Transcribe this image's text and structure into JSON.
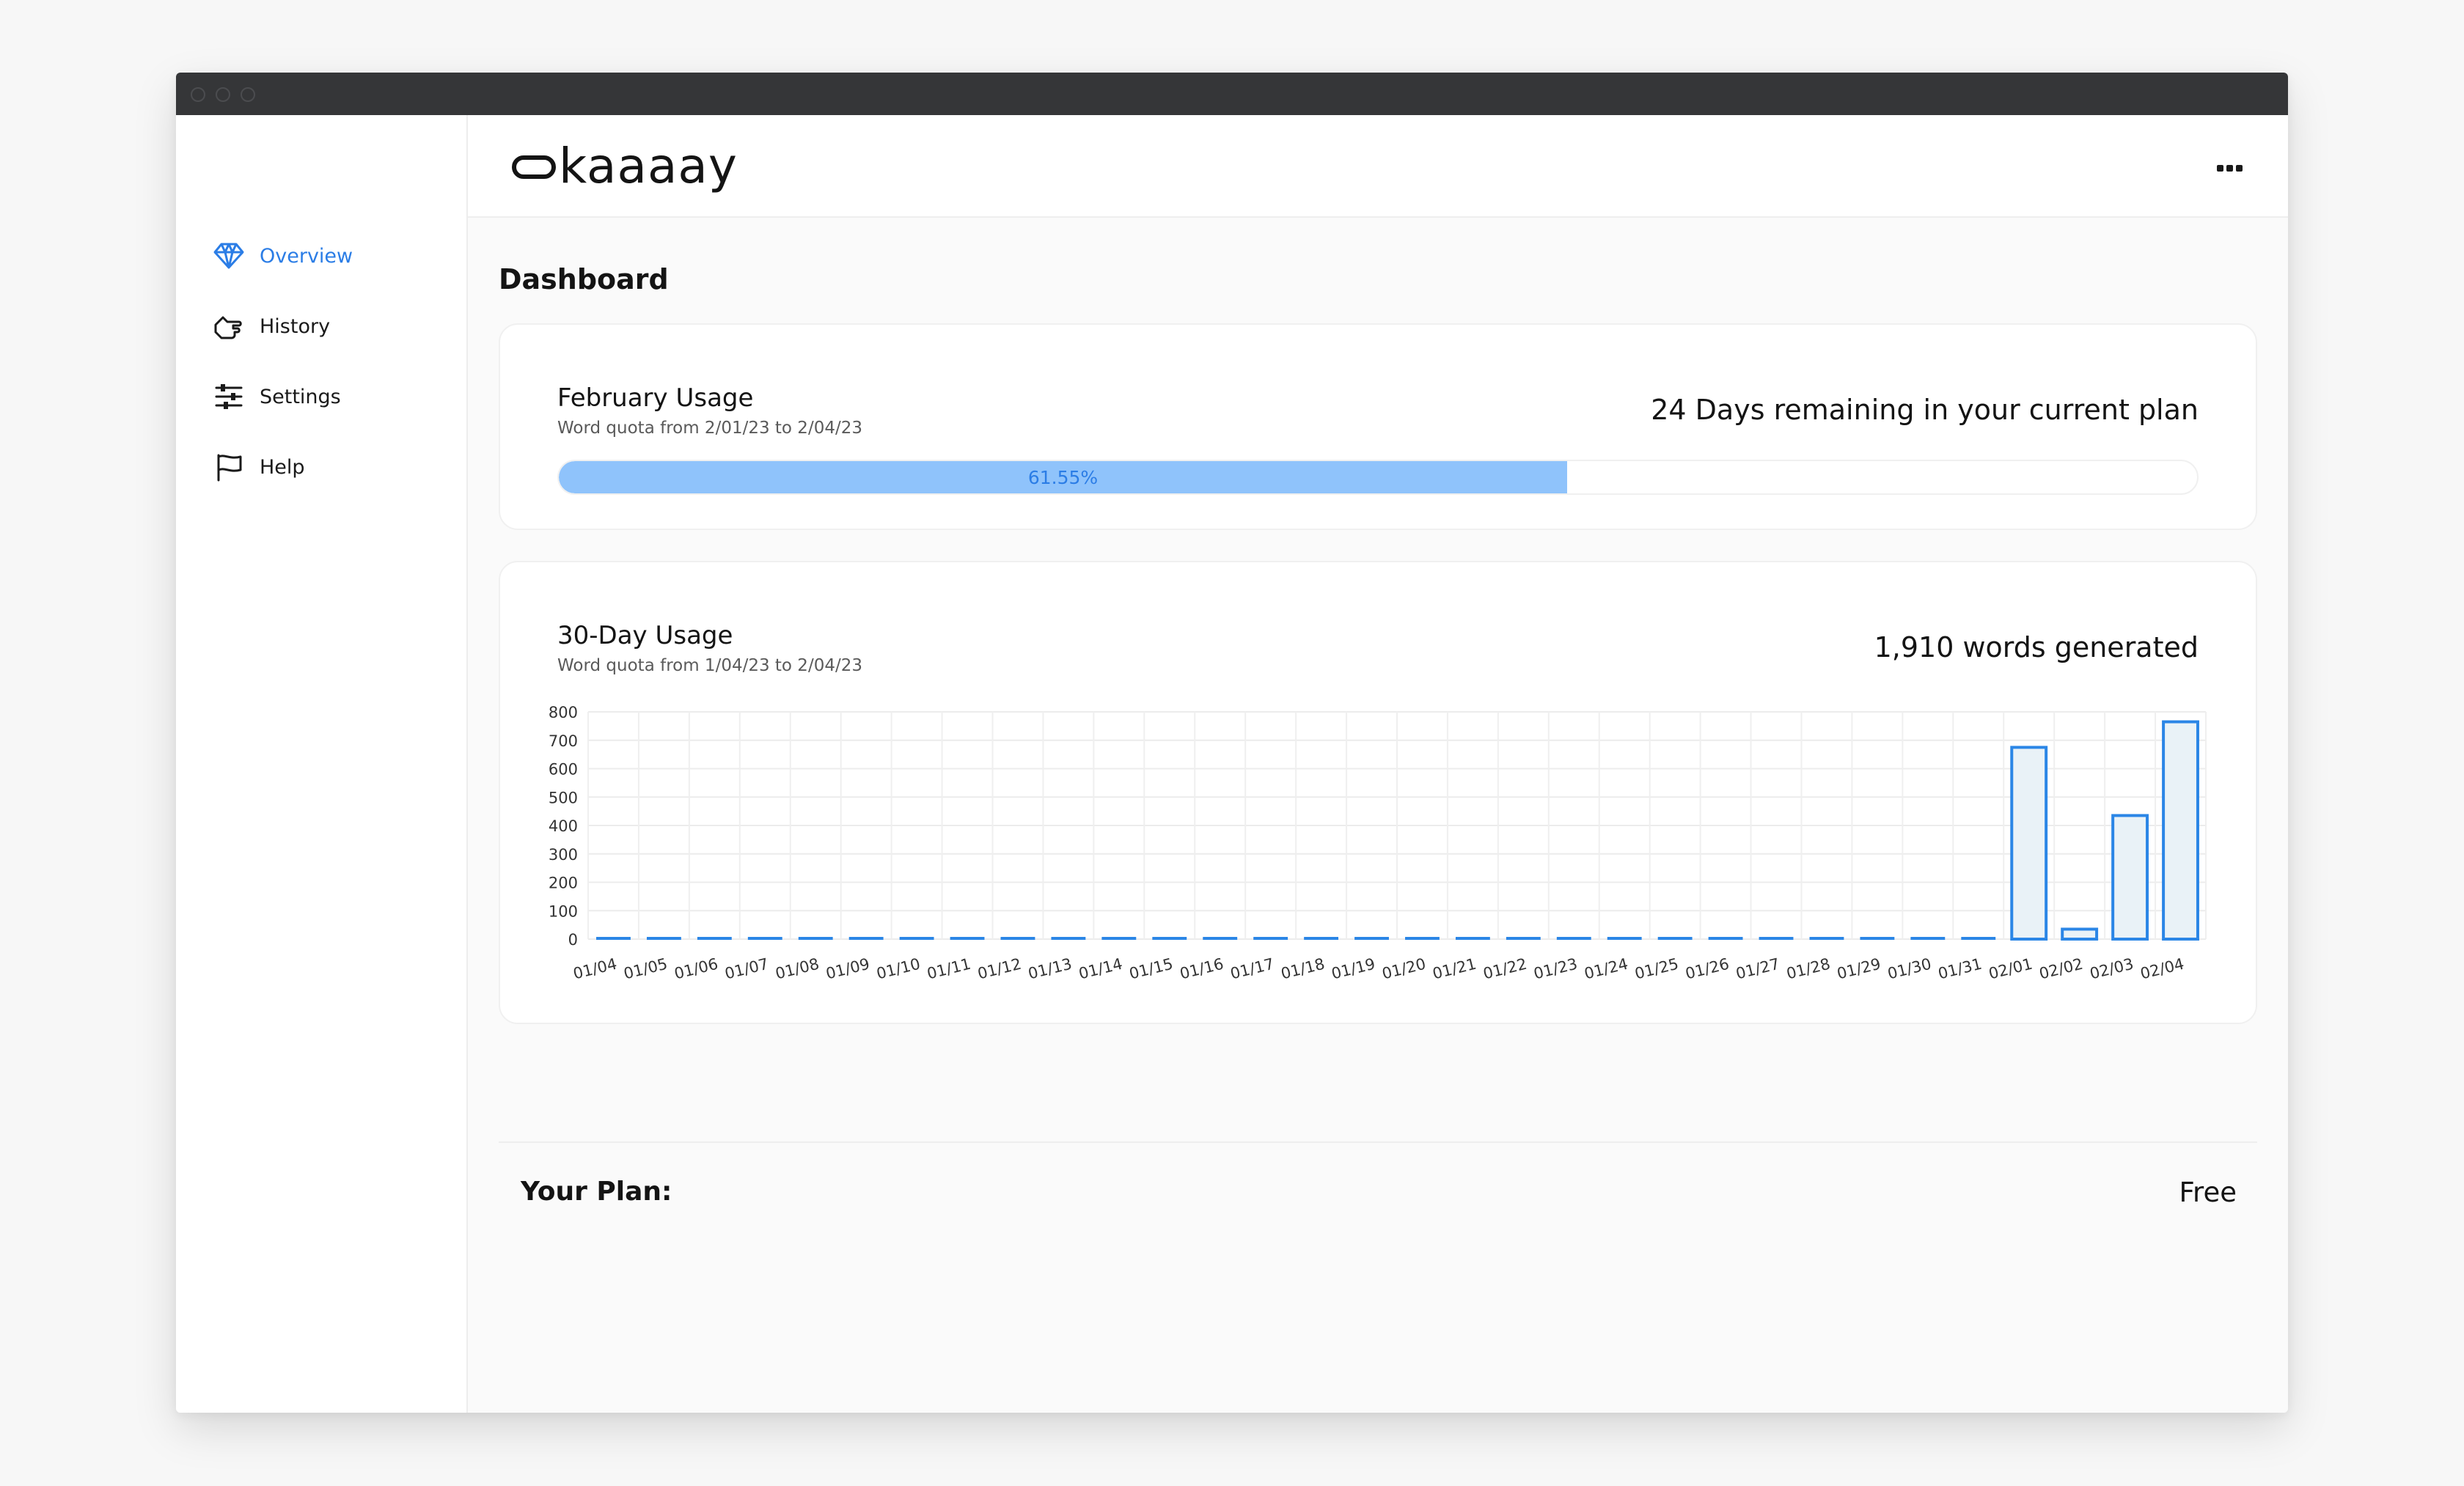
{
  "app": {
    "logo_text": "kaaaay",
    "menu_icon": "more-icon"
  },
  "sidebar": {
    "items": [
      {
        "label": "Overview",
        "icon": "diamond-icon",
        "active": true
      },
      {
        "label": "History",
        "icon": "hand-point-icon",
        "active": false
      },
      {
        "label": "Settings",
        "icon": "sliders-icon",
        "active": false
      },
      {
        "label": "Help",
        "icon": "flag-icon",
        "active": false
      }
    ]
  },
  "page": {
    "title": "Dashboard"
  },
  "usage_card": {
    "title": "February Usage",
    "subtitle": "Word quota from 2/01/23 to 2/04/23",
    "remaining": "24 Days remaining in your current plan",
    "progress_fraction": 0.6155,
    "progress_label": "61.55%"
  },
  "chart_card": {
    "title": "30-Day Usage",
    "subtitle": "Word quota from 1/04/23 to 2/04/23",
    "total": "1,910 words generated"
  },
  "chart_data": {
    "type": "bar",
    "categories": [
      "01/04",
      "01/05",
      "01/06",
      "01/07",
      "01/08",
      "01/09",
      "01/10",
      "01/11",
      "01/12",
      "01/13",
      "01/14",
      "01/15",
      "01/16",
      "01/17",
      "01/18",
      "01/19",
      "01/20",
      "01/21",
      "01/22",
      "01/23",
      "01/24",
      "01/25",
      "01/26",
      "01/27",
      "01/28",
      "01/29",
      "01/30",
      "01/31",
      "02/01",
      "02/02",
      "02/03",
      "02/04"
    ],
    "values": [
      0,
      0,
      0,
      0,
      0,
      0,
      0,
      0,
      0,
      0,
      0,
      0,
      0,
      0,
      0,
      0,
      0,
      0,
      0,
      0,
      0,
      0,
      0,
      0,
      0,
      0,
      0,
      0,
      675,
      35,
      435,
      765
    ],
    "y_ticks": [
      "0",
      "100",
      "200",
      "300",
      "400",
      "500",
      "600",
      "700",
      "800"
    ],
    "ylim": [
      0,
      800
    ],
    "grid": true,
    "legend": "none",
    "bar_color": "#2b86e6",
    "bar_fill": "#e9f2f7"
  },
  "plan": {
    "label": "Your Plan:",
    "value": "Free"
  },
  "colors": {
    "accent": "#2b7de6",
    "progress": "#8fc3fb",
    "titlebar": "#353638"
  }
}
